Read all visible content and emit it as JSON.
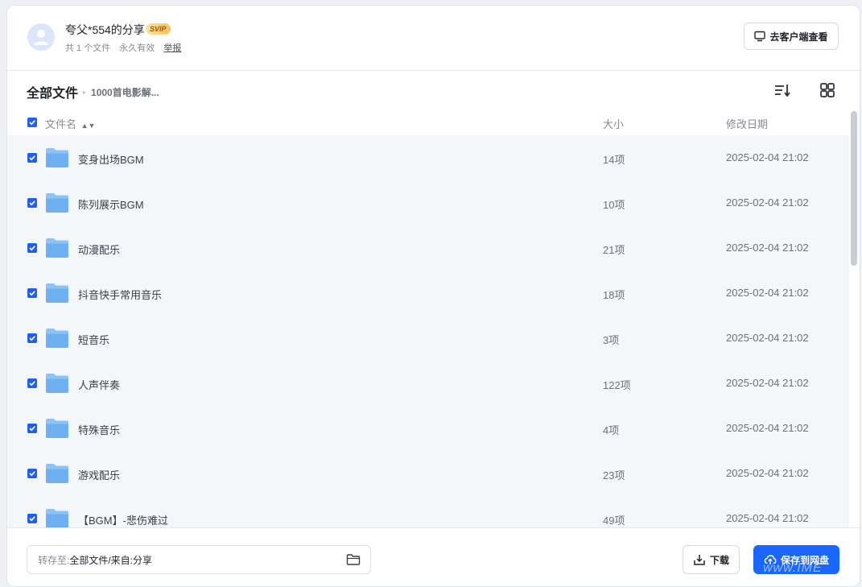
{
  "header": {
    "share_title": "夸父*554的分享",
    "vip_badge": "SVIP",
    "file_count": "共 1 个文件",
    "validity": "永久有效",
    "report": "举报",
    "client_button": "去客户端查看"
  },
  "breadcrumb": {
    "root": "全部文件",
    "current": "1000首电影解..."
  },
  "table": {
    "columns": {
      "name": "文件名",
      "size": "大小",
      "date": "修改日期"
    },
    "rows": [
      {
        "name": "变身出场BGM",
        "size": "14项",
        "date": "2025-02-04 21:02"
      },
      {
        "name": "陈列展示BGM",
        "size": "10项",
        "date": "2025-02-04 21:02"
      },
      {
        "name": "动漫配乐",
        "size": "21项",
        "date": "2025-02-04 21:02"
      },
      {
        "name": "抖音快手常用音乐",
        "size": "18项",
        "date": "2025-02-04 21:02"
      },
      {
        "name": "短音乐",
        "size": "3项",
        "date": "2025-02-04 21:02"
      },
      {
        "name": "人声伴奏",
        "size": "122项",
        "date": "2025-02-04 21:02"
      },
      {
        "name": "特殊音乐",
        "size": "4项",
        "date": "2025-02-04 21:02"
      },
      {
        "name": "游戏配乐",
        "size": "23项",
        "date": "2025-02-04 21:02"
      },
      {
        "name": "【BGM】-悲伤难过",
        "size": "49项",
        "date": "2025-02-04 21:02"
      }
    ]
  },
  "footer": {
    "save_label": "转存至:",
    "save_path": "全部文件/来自:分享",
    "download_button": "下载",
    "save_button": "保存到网盘"
  },
  "watermark": "www.IME",
  "colors": {
    "accent": "#1967ff",
    "checkbox": "#2060f0",
    "folder": "#7db8f5"
  },
  "icons": {
    "avatar": "user-avatar",
    "client": "monitor-icon",
    "sort": "sort-list-icon",
    "grid": "grid-view-icon",
    "folder": "folder-icon",
    "download": "download-icon",
    "save": "cloud-upload-icon"
  }
}
